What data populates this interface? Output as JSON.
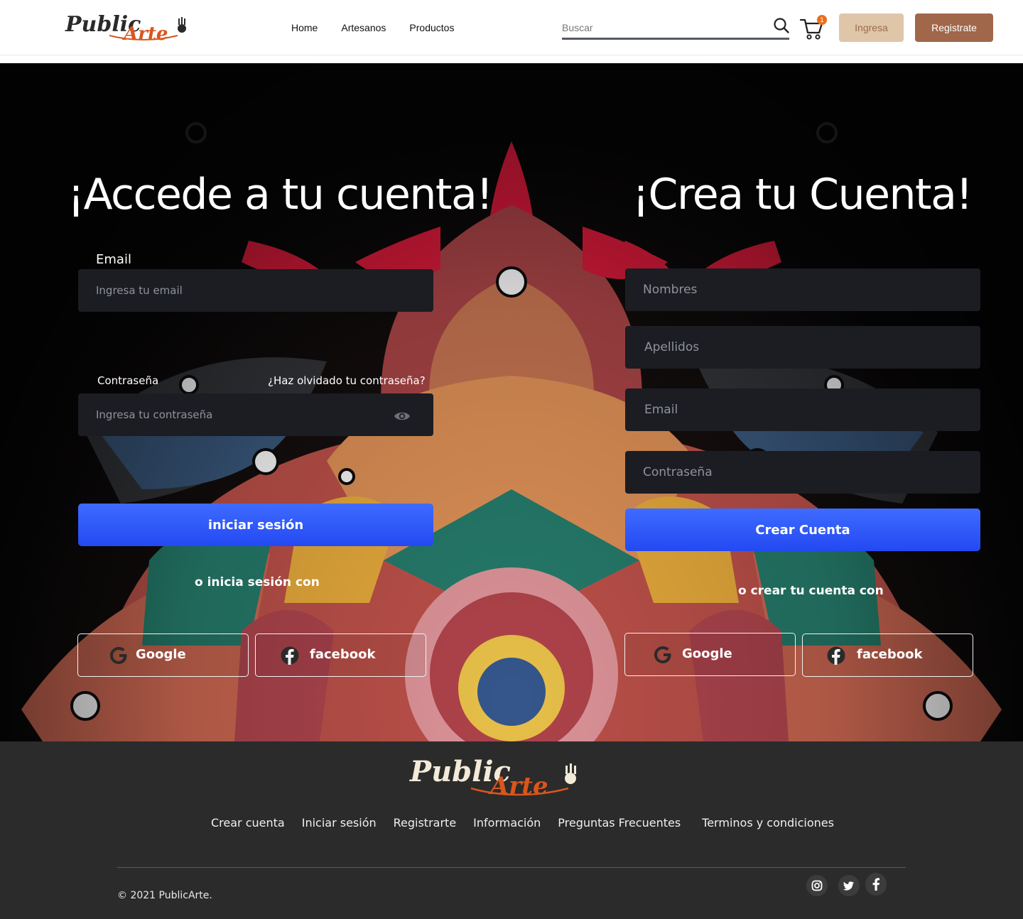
{
  "header": {
    "logo_alt": "PublicArte",
    "nav": [
      "Home",
      "Artesanos",
      "Productos"
    ],
    "search_placeholder": "Buscar",
    "cart_count": "1",
    "login_label": "Ingresa",
    "register_label": "Registrate"
  },
  "login": {
    "title": "¡Accede a tu cuenta!",
    "email_label": "Email",
    "email_placeholder": "Ingresa tu email",
    "password_label": "Contraseña",
    "forgot_label": "¿Haz olvidado tu contraseña?",
    "password_placeholder": "Ingresa tu contraseña",
    "submit_label": "iniciar sesión",
    "alt_text": "o inicia sesión con",
    "google_label": "Google",
    "facebook_label": "facebook"
  },
  "signup": {
    "title": "¡Crea tu Cuenta!",
    "names_placeholder": "Nombres",
    "lastnames_placeholder": "Apellidos",
    "email_placeholder": "Email",
    "password_placeholder": "Contraseña",
    "submit_label": "Crear Cuenta",
    "alt_text": "o crear tu cuenta con",
    "google_label": "Google",
    "facebook_label": "facebook"
  },
  "footer": {
    "links": [
      "Crear cuenta",
      "Iniciar sesión",
      "Registrarte",
      "Información",
      "Preguntas Frecuentes",
      "Terminos y condiciones"
    ],
    "copyright": "© 2021 PublicArte."
  },
  "colors": {
    "accent_button": "#2d55f8",
    "brand_brown": "#a0674a",
    "brand_tan": "#dfc6a8",
    "brand_orange": "#d9561d",
    "footer_bg": "#2b2b2b"
  },
  "icons": [
    "search-icon",
    "cart-icon",
    "eye-icon",
    "google-icon",
    "facebook-icon",
    "instagram-icon",
    "twitter-icon"
  ]
}
